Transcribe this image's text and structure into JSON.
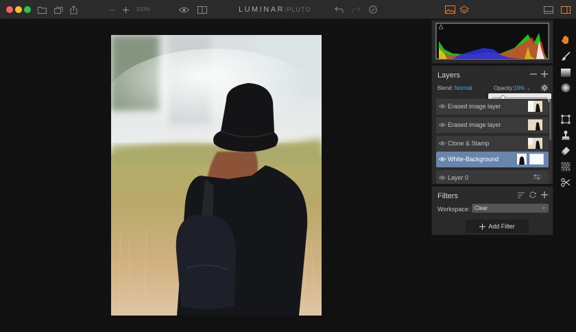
{
  "window": {
    "controls": [
      "close",
      "minimize",
      "zoom"
    ],
    "title": "LUMINAR",
    "title_suffix": "/PLUTO",
    "zoom_level": "100%"
  },
  "colors": {
    "accent": "#e8832a",
    "link": "#4fb0d8",
    "selected_layer": "#6886ac"
  },
  "toolbar_icons": [
    "folder-icon",
    "batch-icon",
    "share-icon",
    "zoom-out-icon",
    "zoom-in-icon",
    "eye-icon",
    "compare-icon",
    "undo-icon",
    "redo-icon",
    "history-icon",
    "image-icon",
    "layers-icon",
    "filmstrip-icon",
    "panel-toggle-icon"
  ],
  "tools": [
    "hand-icon",
    "brush-icon",
    "gradient-icon",
    "radial-icon",
    "crop-icon",
    "clone-stamp-icon",
    "eraser-icon",
    "noise-icon",
    "scissors-icon"
  ],
  "layers_panel": {
    "title": "Layers",
    "blend_label": "Blend:",
    "blend_value": "Normal",
    "opacity_label": "Opacity:",
    "opacity_value": "19%",
    "opacity_fraction": 0.19,
    "items": [
      {
        "name": "Erased image layer",
        "selected": false
      },
      {
        "name": "Erased image layer",
        "selected": false
      },
      {
        "name": "Clone & Stamp",
        "selected": false
      },
      {
        "name": "White-Background",
        "selected": true
      },
      {
        "name": "Layer 0",
        "selected": false
      }
    ]
  },
  "filters_panel": {
    "title": "Filters",
    "workspace_label": "Workspace:",
    "workspace_value": "Clear",
    "add_filter_label": "Add Filter"
  }
}
